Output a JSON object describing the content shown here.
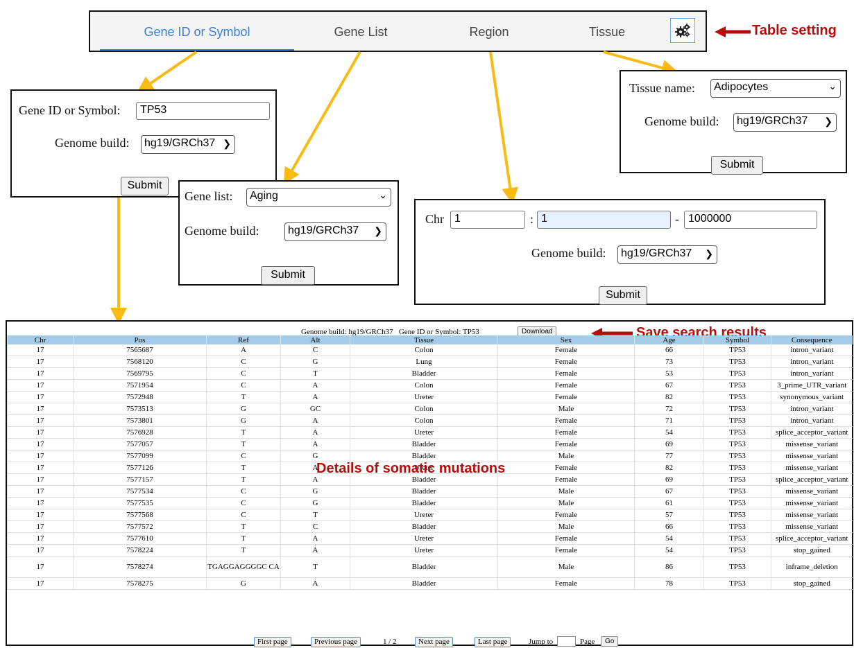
{
  "tabs": {
    "gene_id": "Gene ID or Symbol",
    "gene_list": "Gene List",
    "region": "Region",
    "tissue": "Tissue",
    "settings_icon": "gears-icon"
  },
  "annotations": {
    "table_setting": "Table setting",
    "save_results": "Save search results",
    "details": "Details of somatic mutations"
  },
  "gene_id_form": {
    "label": "Gene ID or Symbol:",
    "value": "TP53",
    "build_label": "Genome build:",
    "build_value": "hg19/GRCh37",
    "submit": "Submit"
  },
  "gene_list_form": {
    "label": "Gene list:",
    "value": "Aging",
    "build_label": "Genome build:",
    "build_value": "hg19/GRCh37",
    "submit": "Submit"
  },
  "region_form": {
    "chr_label": "Chr",
    "chr_value": "1",
    "colon": ":",
    "start_value": "1",
    "dash": "-",
    "end_value": "1000000",
    "build_label": "Genome build:",
    "build_value": "hg19/GRCh37",
    "submit": "Submit"
  },
  "tissue_form": {
    "label": "Tissue name:",
    "value": "Adipocytes",
    "build_label": "Genome build:",
    "build_value": "hg19/GRCh37",
    "submit": "Submit"
  },
  "results": {
    "summary": "Genome build: hg19/GRCh37   Gene ID or Symbol: TP53",
    "download": "Download",
    "columns": [
      "Chr",
      "Pos",
      "Ref",
      "Alt",
      "Tissue",
      "Sex",
      "Age",
      "Symbol",
      "Consequence"
    ],
    "rows": [
      [
        "17",
        "7565687",
        "A",
        "C",
        "Colon",
        "Female",
        "66",
        "TP53",
        "intron_variant"
      ],
      [
        "17",
        "7568120",
        "C",
        "G",
        "Lung",
        "Female",
        "73",
        "TP53",
        "intron_variant"
      ],
      [
        "17",
        "7569795",
        "C",
        "T",
        "Bladder",
        "Female",
        "53",
        "TP53",
        "intron_variant"
      ],
      [
        "17",
        "7571954",
        "C",
        "A",
        "Colon",
        "Female",
        "67",
        "TP53",
        "3_prime_UTR_variant"
      ],
      [
        "17",
        "7572948",
        "T",
        "A",
        "Ureter",
        "Female",
        "82",
        "TP53",
        "synonymous_variant"
      ],
      [
        "17",
        "7573513",
        "G",
        "GC",
        "Colon",
        "Male",
        "72",
        "TP53",
        "intron_variant"
      ],
      [
        "17",
        "7573801",
        "G",
        "A",
        "Colon",
        "Female",
        "71",
        "TP53",
        "intron_variant"
      ],
      [
        "17",
        "7576928",
        "T",
        "A",
        "Ureter",
        "Female",
        "54",
        "TP53",
        "splice_acceptor_variant"
      ],
      [
        "17",
        "7577057",
        "T",
        "A",
        "Bladder",
        "Female",
        "69",
        "TP53",
        "missense_variant"
      ],
      [
        "17",
        "7577099",
        "C",
        "G",
        "Bladder",
        "Male",
        "77",
        "TP53",
        "missense_variant"
      ],
      [
        "17",
        "7577126",
        "T",
        "A",
        "Ureter",
        "Female",
        "82",
        "TP53",
        "missense_variant"
      ],
      [
        "17",
        "7577157",
        "T",
        "A",
        "Bladder",
        "Female",
        "69",
        "TP53",
        "splice_acceptor_variant"
      ],
      [
        "17",
        "7577534",
        "C",
        "G",
        "Bladder",
        "Male",
        "67",
        "TP53",
        "missense_variant"
      ],
      [
        "17",
        "7577535",
        "C",
        "G",
        "Bladder",
        "Male",
        "61",
        "TP53",
        "missense_variant"
      ],
      [
        "17",
        "7577568",
        "C",
        "T",
        "Ureter",
        "Female",
        "57",
        "TP53",
        "missense_variant"
      ],
      [
        "17",
        "7577572",
        "T",
        "C",
        "Bladder",
        "Male",
        "66",
        "TP53",
        "missense_variant"
      ],
      [
        "17",
        "7577610",
        "T",
        "A",
        "Ureter",
        "Female",
        "54",
        "TP53",
        "splice_acceptor_variant"
      ],
      [
        "17",
        "7578224",
        "T",
        "A",
        "Ureter",
        "Female",
        "54",
        "TP53",
        "stop_gained"
      ],
      [
        "17",
        "7578274",
        "TGAGGAGGGGC CA",
        "T",
        "Bladder",
        "Male",
        "86",
        "TP53",
        "inframe_deletion"
      ],
      [
        "17",
        "7578275",
        "G",
        "A",
        "Bladder",
        "Female",
        "78",
        "TP53",
        "stop_gained"
      ]
    ]
  },
  "pagination": {
    "first": "First page",
    "prev": "Previous page",
    "current": "1 / 2",
    "next": "Next page",
    "last": "Last page",
    "jump_label": "Jump to",
    "jump_value": "",
    "page_label": "Page",
    "go": "Go"
  },
  "colors": {
    "accent": "#3a7fd5",
    "arrow_yellow": "#f7bb14",
    "annotation_red": "#b50d0d",
    "header_blue": "#a4cce9"
  }
}
